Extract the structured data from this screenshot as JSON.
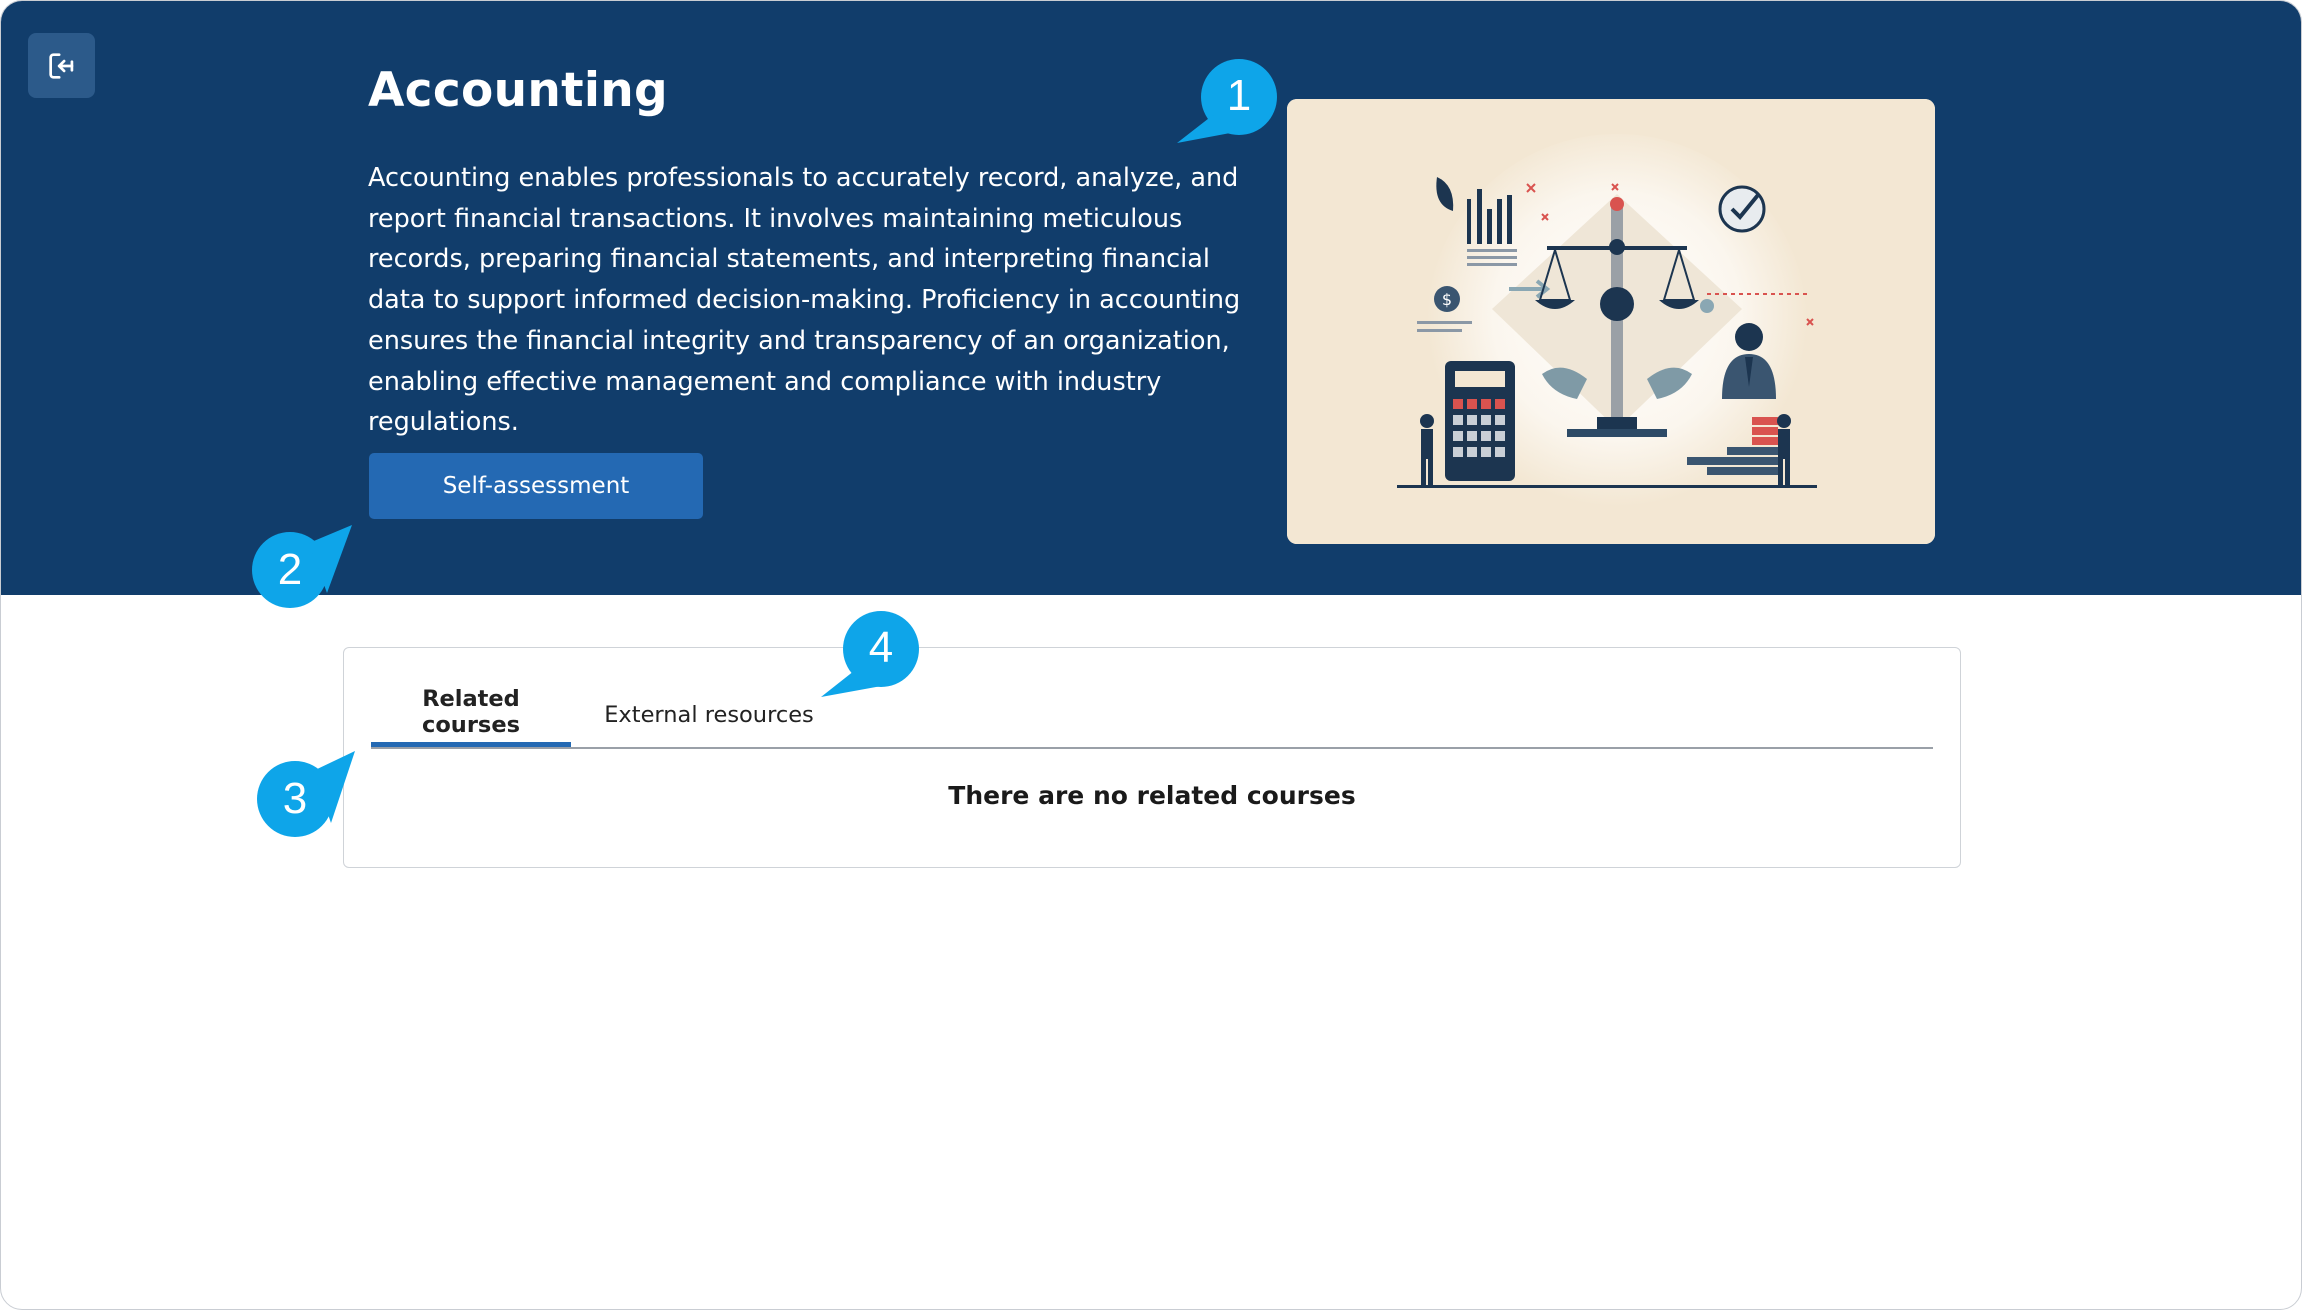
{
  "header": {
    "title": "Accounting",
    "description": "Accounting enables professionals to accurately record, analyze, and report financial transactions. It involves maintaining meticulous records, preparing financial statements, and interpreting financial data to support informed decision-making. Proficiency in accounting ensures the financial integrity and transparency of an organization, enabling effective management and compliance with industry regulations.",
    "exit_icon": "exit-icon",
    "self_assessment_label": "Self-assessment",
    "illustration": "accounting-illustration"
  },
  "tabs": {
    "items": [
      {
        "label": "Related courses",
        "active": true
      },
      {
        "label": "External resources",
        "active": false
      }
    ],
    "empty_message": "There are no related courses"
  },
  "callouts": [
    "1",
    "2",
    "3",
    "4"
  ],
  "colors": {
    "hero_bg": "#113d6b",
    "button": "#2469b3",
    "callout": "#0ea5e9",
    "active_tab_underline": "#2469b3"
  }
}
